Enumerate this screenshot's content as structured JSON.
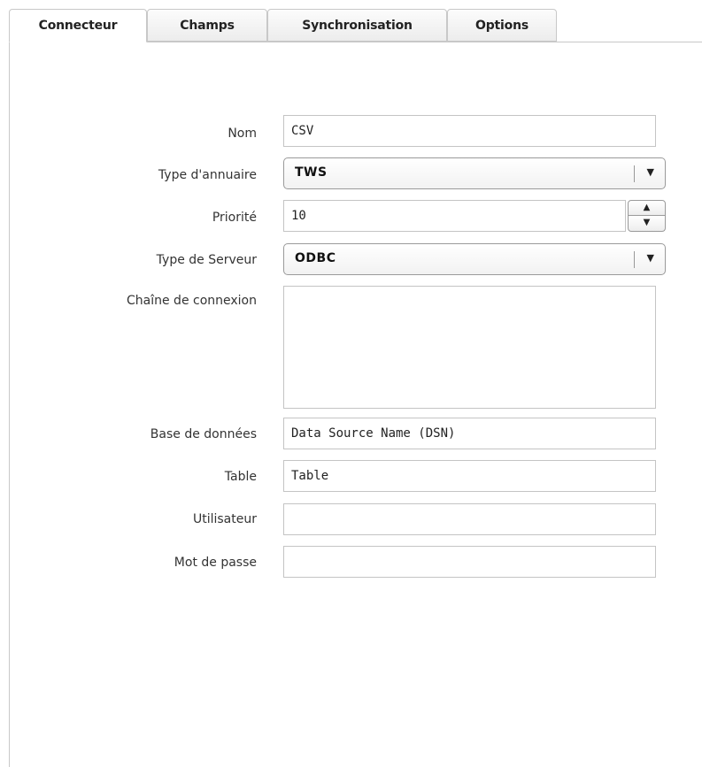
{
  "tabs": [
    {
      "label": "Connecteur",
      "active": true
    },
    {
      "label": "Champs",
      "active": false
    },
    {
      "label": "Synchronisation",
      "active": false
    },
    {
      "label": "Options",
      "active": false
    }
  ],
  "form": {
    "nom": {
      "label": "Nom",
      "value": "CSV"
    },
    "type_annuaire": {
      "label": "Type d'annuaire",
      "value": "TWS"
    },
    "priorite": {
      "label": "Priorité",
      "value": "10"
    },
    "type_serveur": {
      "label": "Type de Serveur",
      "value": "ODBC"
    },
    "chaine_connexion": {
      "label": "Chaîne de connexion",
      "value": ""
    },
    "base_donnees": {
      "label": "Base de données",
      "value": "Data Source Name (DSN)"
    },
    "table": {
      "label": "Table",
      "value": "Table"
    },
    "utilisateur": {
      "label": "Utilisateur",
      "value": ""
    },
    "mot_de_passe": {
      "label": "Mot de passe",
      "value": ""
    }
  },
  "icons": {
    "dropdown": "chevron-down-icon",
    "spin_up": "arrow-up-icon",
    "spin_down": "arrow-down-icon"
  }
}
